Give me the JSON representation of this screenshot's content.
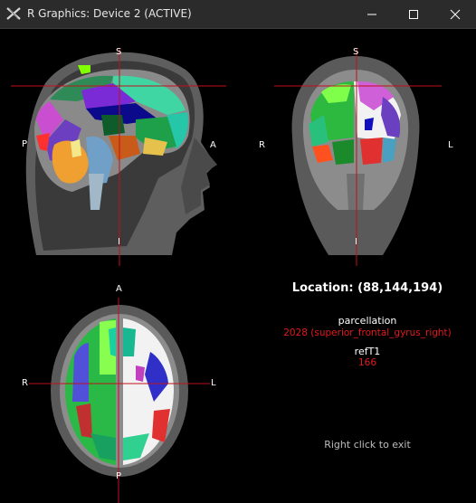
{
  "window": {
    "title": "R Graphics: Device 2 (ACTIVE)",
    "minimize_icon": "minimize-icon",
    "maximize_icon": "maximize-icon",
    "close_icon": "close-icon"
  },
  "sagittal": {
    "top": "S",
    "bottom": "I",
    "left": "P",
    "right": "A"
  },
  "coronal": {
    "top": "S",
    "bottom": "I",
    "left": "R",
    "right": "L"
  },
  "axial": {
    "top": "A",
    "bottom": "P",
    "left": "R",
    "right": "L"
  },
  "info": {
    "location": "Location: (88,144,194)",
    "parcellation_label": "parcellation",
    "parcellation_value": "2028 (superior_frontal_gyrus_right)",
    "reft1_label": "refT1",
    "reft1_value": "166",
    "exit_hint": "Right click to exit"
  },
  "colors": {
    "crosshair": "#c0101a",
    "value_text": "#e31a1c"
  }
}
